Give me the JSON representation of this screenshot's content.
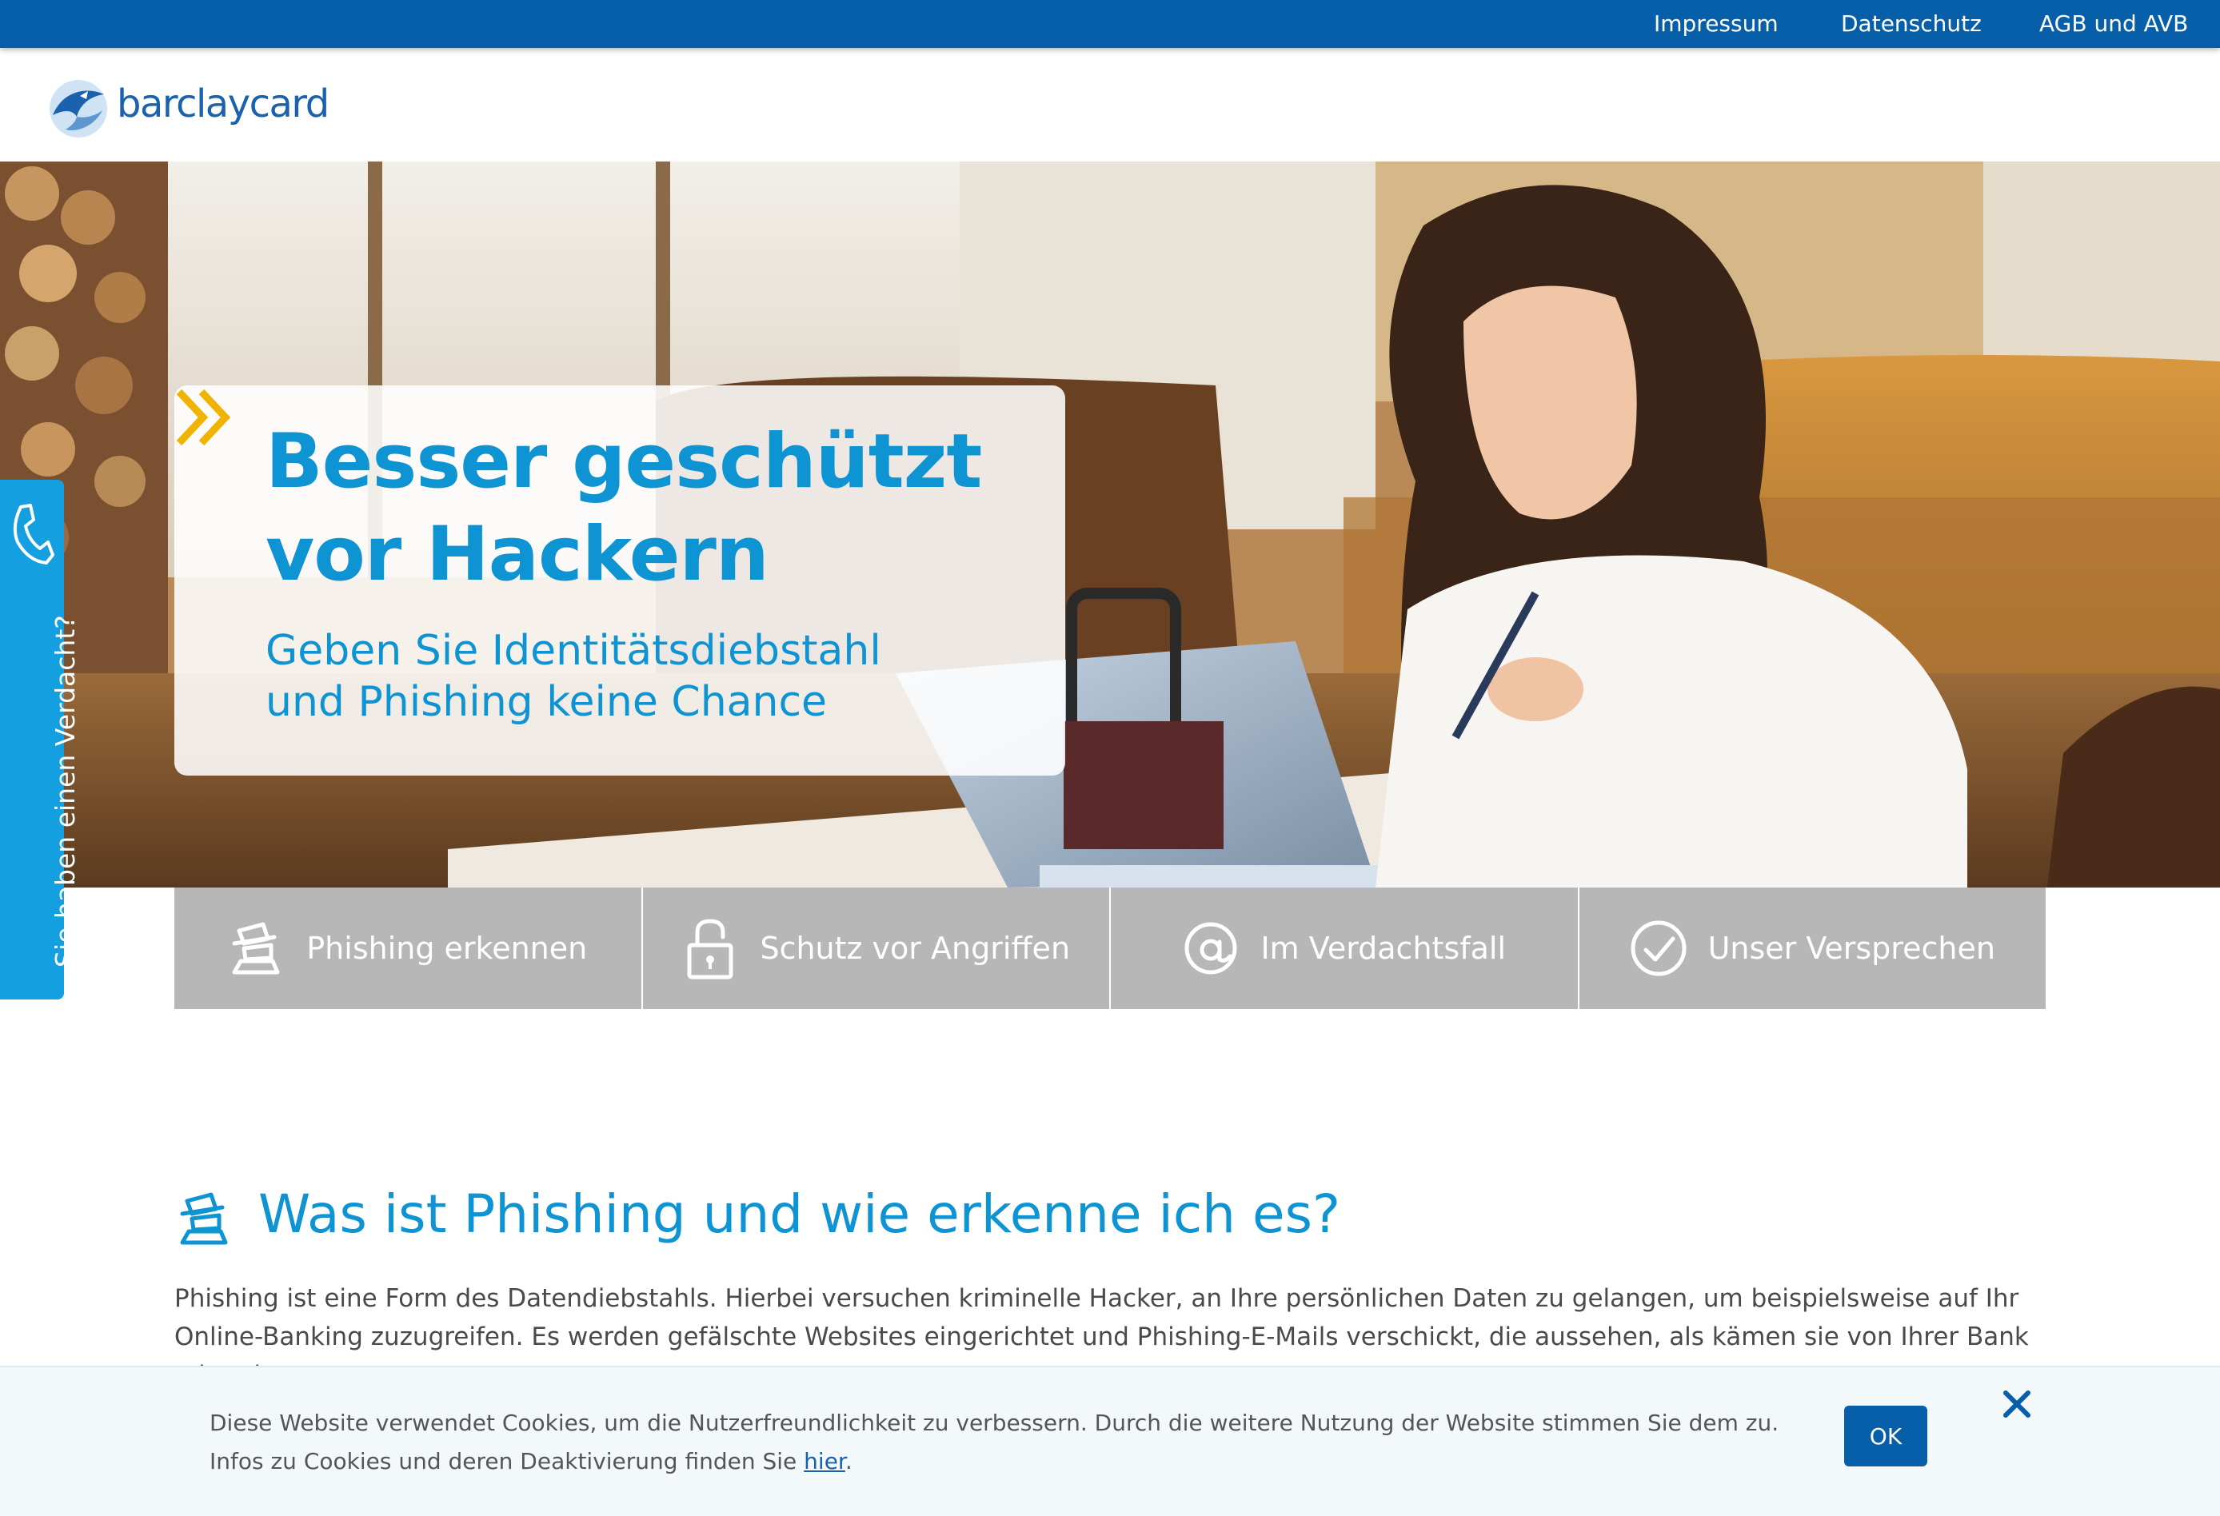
{
  "topbar": {
    "links": [
      "Impressum",
      "Datenschutz",
      "AGB und AVB"
    ]
  },
  "header": {
    "logo_text": "barclaycard"
  },
  "hero": {
    "title_line1": "Besser geschützt",
    "title_line2": "vor Hackern",
    "subtitle_line1": "Geben Sie Identitätsdiebstahl",
    "subtitle_line2": "und Phishing keine Chance"
  },
  "side_tab": {
    "label": "Sie haben einen Verdacht?"
  },
  "tabs": [
    {
      "label": "Phishing erkennen",
      "icon": "phishing-icon"
    },
    {
      "label": "Schutz vor Angriffen",
      "icon": "padlock-icon"
    },
    {
      "label": "Im Verdachtsfall",
      "icon": "at-sign-icon"
    },
    {
      "label": "Unser Versprechen",
      "icon": "checkmark-circle-icon"
    }
  ],
  "section": {
    "title": "Was ist Phishing und wie erkenne ich es?",
    "text": "Phishing ist eine Form des Datendiebstahls. Hierbei versuchen kriminelle Hacker, an Ihre persönlichen Daten zu gelangen, um beispielsweise auf Ihr Online-Banking zuzugreifen. Es werden gefälschte Websites eingerichtet und Phishing-E-Mails verschickt, die aussehen, als kämen sie von Ihrer Bank oder einem"
  },
  "cookie": {
    "text_before": "Diese Website verwendet Cookies, um die Nutzerfreundlichkeit zu verbessern. Durch die weitere Nutzung der Website stimmen Sie dem zu. Infos zu Cookies und deren Deaktivierung finden Sie ",
    "link": "hier",
    "text_after": ".",
    "ok_label": "OK"
  },
  "colors": {
    "topbar": "#075ea9",
    "brand_blue": "#0e93d3",
    "tab_grey": "#b7b7b7",
    "side_tab": "#14a0e0",
    "accent_yellow": "#f0b400"
  }
}
